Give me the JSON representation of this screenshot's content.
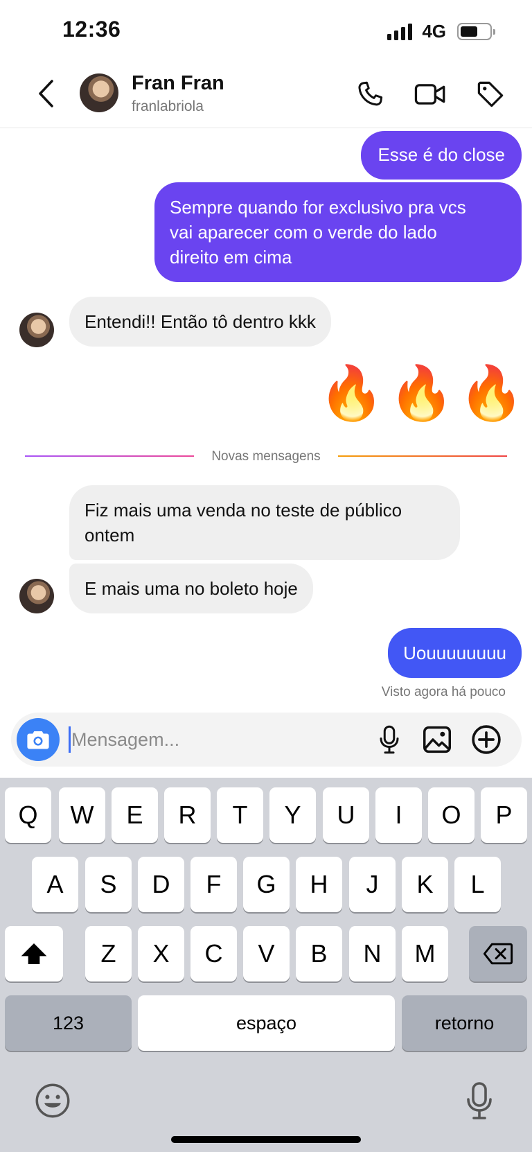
{
  "status_bar": {
    "time": "12:36",
    "network": "4G"
  },
  "header": {
    "name": "Fran Fran",
    "handle": "franlabriola"
  },
  "messages": {
    "m1": "Esse é do close",
    "m2_l1": "Sempre quando for exclusivo pra vcs",
    "m2_l2": "vai aparecer com o verde do lado",
    "m2_l3": "direito em cima",
    "m3": "Entendi!! Então tô dentro kkk",
    "reaction_emoji": "🔥",
    "new_messages_divider": "Novas mensagens",
    "m4_l1": "Fiz mais uma venda no teste de público",
    "m4_l2": "ontem",
    "m5": "E mais uma no boleto hoje",
    "m6": "Uouuuuuuuu",
    "seen": "Visto agora há pouco"
  },
  "composer": {
    "placeholder": "Mensagem..."
  },
  "keyboard": {
    "row1": [
      "Q",
      "W",
      "E",
      "R",
      "T",
      "Y",
      "U",
      "I",
      "O",
      "P"
    ],
    "row2": [
      "A",
      "S",
      "D",
      "F",
      "G",
      "H",
      "J",
      "K",
      "L"
    ],
    "row3": [
      "Z",
      "X",
      "C",
      "V",
      "B",
      "N",
      "M"
    ],
    "numbers": "123",
    "space": "espaço",
    "return": "retorno"
  },
  "colors": {
    "outgoing_bubble": "#6a44f0",
    "outgoing_bubble_recent": "#4257f5",
    "incoming_bubble": "#efefef",
    "camera_button": "#3b82f6"
  }
}
